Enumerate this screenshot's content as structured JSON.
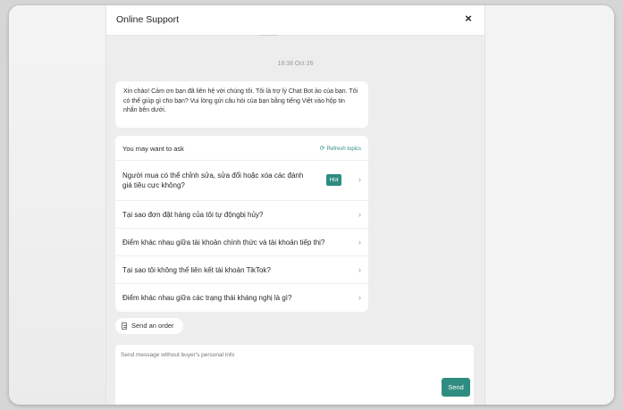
{
  "header": {
    "title": "Online Support",
    "close_glyph": "×",
    "close_icon": "close-icon"
  },
  "chat": {
    "timestamp": "18:38 Oct 26",
    "greeting": "Xin chào! Cảm ơn bạn đã liên hệ với chúng tôi. Tôi là trợ lý Chat Bot ảo của bạn. Tôi có thể giúp gì cho bạn? Vui lòng gửi câu hỏi của bạn bằng tiếng Việt vào hộp tin nhắn bên dưới."
  },
  "topics": {
    "title": "You may want to ask",
    "refresh_label": "Refresh topics",
    "refresh_icon": "refresh-icon",
    "hot_label": "Hot",
    "chevron": "›",
    "items": [
      {
        "label": "Người mua có thể chỉnh sửa, sửa đổi hoặc xóa các đánh giá tiêu cực không?"
      },
      {
        "label": "Tại sao đơn đặt hàng của tôi tự độngbị hủy?"
      },
      {
        "label": "Điểm khác nhau giữa tài khoản chính thức và tài khoản tiếp thị?"
      },
      {
        "label": "Tại sao tôi không thể liên kết tài khoản TikTok?"
      },
      {
        "label": "Điểm khác nhau giữa các trạng thái kháng nghị là gì?"
      }
    ]
  },
  "actions": {
    "send_order_label": "Send an order",
    "order_icon": "document-icon"
  },
  "composer": {
    "placeholder": "Send message without buyer's personal info",
    "send_label": "Send"
  },
  "colors": {
    "accent": "#2e8c80",
    "panel_bg": "#ededed",
    "page_bg": "#d6d6d6"
  }
}
